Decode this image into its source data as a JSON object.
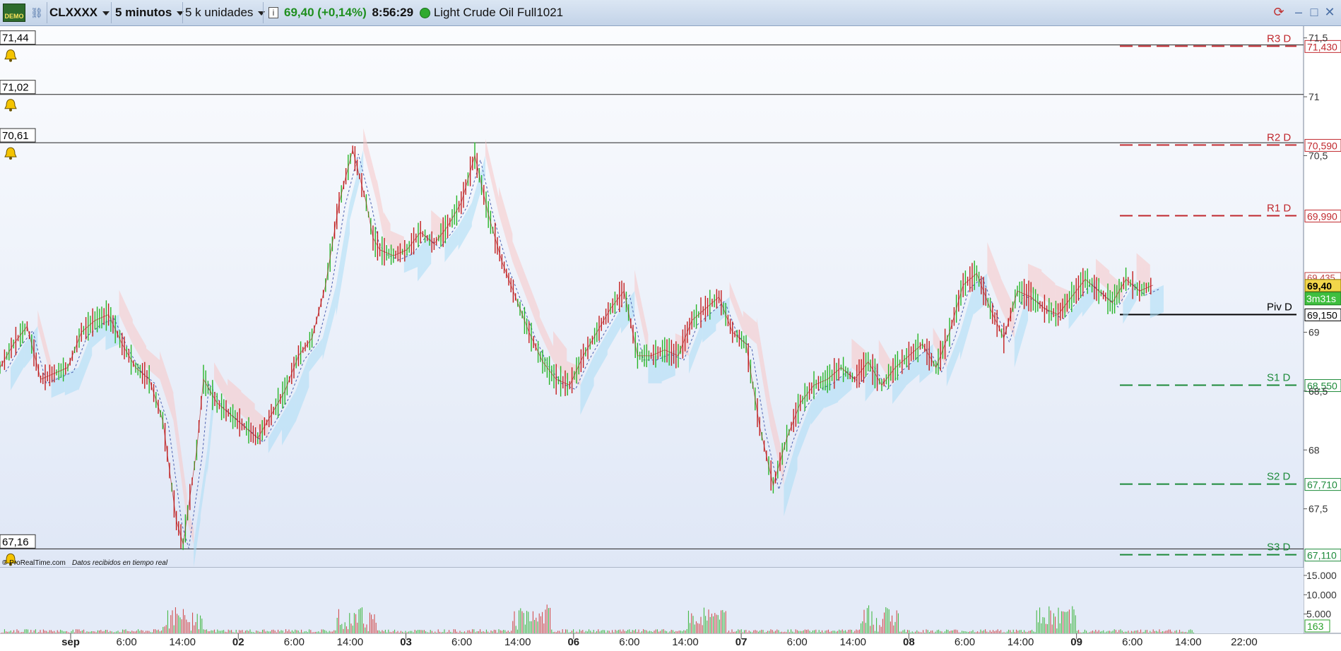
{
  "toolbar": {
    "demo_label": "DEMO",
    "symbol": "CLXXXX",
    "timeframe": "5 minutos",
    "units": "5 k unidades",
    "price": "69,40",
    "change": "(+0,14%)",
    "time": "8:56:29",
    "instrument": "Light Crude Oil Full1021",
    "icons": [
      "demo-icon",
      "link-icon",
      "dropdown-icon",
      "info-icon",
      "live-status-icon",
      "sync-icon",
      "minimize-icon",
      "maximize-icon",
      "close-icon"
    ]
  },
  "credits": {
    "source": "© ProRealTime.com",
    "note": "Datos recibidos en tiempo real"
  },
  "chart_data": {
    "type": "line",
    "title": "",
    "price_axis": {
      "ticks": [
        "71,5",
        "71",
        "70,5",
        "69",
        "68,5",
        "68",
        "67,5"
      ],
      "ylim": [
        67.0,
        71.6
      ]
    },
    "x_axis": {
      "ticks": [
        "sep",
        "6:00",
        "14:00",
        "02",
        "6:00",
        "14:00",
        "03",
        "6:00",
        "14:00",
        "06",
        "6:00",
        "14:00",
        "07",
        "6:00",
        "14:00",
        "08",
        "6:00",
        "14:00",
        "09",
        "6:00",
        "14:00",
        "22:00"
      ]
    },
    "alert_lines": [
      {
        "label": "71,44",
        "value": 71.44
      },
      {
        "label": "71,02",
        "value": 71.02
      },
      {
        "label": "70,61",
        "value": 70.61
      },
      {
        "label": "67,16",
        "value": 67.16
      }
    ],
    "pivot_levels": [
      {
        "name": "R3 D",
        "value": 71.43,
        "label": "71,430",
        "color": "#c0282d"
      },
      {
        "name": "R2 D",
        "value": 70.59,
        "label": "70,590",
        "color": "#c0282d"
      },
      {
        "name": "R1 D",
        "value": 69.99,
        "label": "69,990",
        "color": "#c0282d"
      },
      {
        "name": "Piv D",
        "value": 69.15,
        "label": "69,150",
        "color": "#000000"
      },
      {
        "name": "S1 D",
        "value": 68.55,
        "label": "68,550",
        "color": "#1d8a3a"
      },
      {
        "name": "S2 D",
        "value": 67.71,
        "label": "67,710",
        "color": "#1d8a3a"
      },
      {
        "name": "S3 D",
        "value": 67.11,
        "label": "67,110",
        "color": "#1d8a3a"
      }
    ],
    "current_price": {
      "label": "69,40",
      "value": 69.4
    },
    "extra_price_label": {
      "label": "69,435",
      "value": 69.435
    },
    "countdown": "3m31s",
    "series": [
      {
        "name": "price",
        "x": [
          0,
          2,
          4,
          6,
          8,
          10,
          12,
          14,
          16,
          18,
          20,
          22,
          24,
          26,
          27,
          28,
          29,
          30,
          32,
          34,
          36,
          38,
          40,
          42,
          44,
          46,
          48,
          50,
          52,
          54,
          55,
          56,
          58,
          60,
          62,
          64,
          66,
          68,
          70,
          72,
          74,
          76,
          78,
          80,
          82,
          84,
          86,
          88,
          90,
          92,
          94,
          96,
          98,
          100,
          102,
          104,
          106,
          108,
          110,
          112,
          114,
          116,
          118,
          120,
          122,
          124,
          126,
          128,
          130,
          132,
          134,
          136,
          138,
          140,
          142,
          144,
          146,
          148,
          150,
          152,
          154,
          156,
          158,
          160,
          162,
          164,
          166,
          168,
          170
        ],
        "values": [
          68.7,
          68.9,
          69.05,
          68.6,
          68.65,
          68.7,
          69.0,
          69.1,
          69.15,
          68.9,
          68.7,
          68.6,
          68.25,
          67.4,
          67.2,
          67.6,
          68.0,
          68.6,
          68.4,
          68.3,
          68.2,
          68.1,
          68.3,
          68.5,
          68.8,
          68.95,
          69.4,
          70.1,
          70.55,
          70.1,
          69.8,
          69.7,
          69.65,
          69.7,
          69.85,
          69.75,
          69.9,
          70.1,
          70.5,
          70.0,
          69.6,
          69.3,
          69.0,
          68.75,
          68.6,
          68.55,
          68.8,
          69.0,
          69.2,
          69.35,
          68.8,
          68.8,
          68.85,
          68.8,
          69.1,
          69.2,
          69.3,
          69.0,
          68.9,
          68.2,
          67.7,
          68.1,
          68.4,
          68.55,
          68.6,
          68.7,
          68.6,
          68.75,
          68.55,
          68.7,
          68.8,
          68.9,
          68.7,
          69.0,
          69.4,
          69.5,
          69.2,
          68.95,
          69.35,
          69.3,
          69.2,
          69.15,
          69.3,
          69.45,
          69.35,
          69.25,
          69.45,
          69.35,
          69.4
        ]
      }
    ],
    "volume_axis": {
      "ticks": [
        "15.000",
        "10.000",
        "5.000"
      ],
      "current": "163",
      "ylim": [
        0,
        17000
      ]
    }
  }
}
